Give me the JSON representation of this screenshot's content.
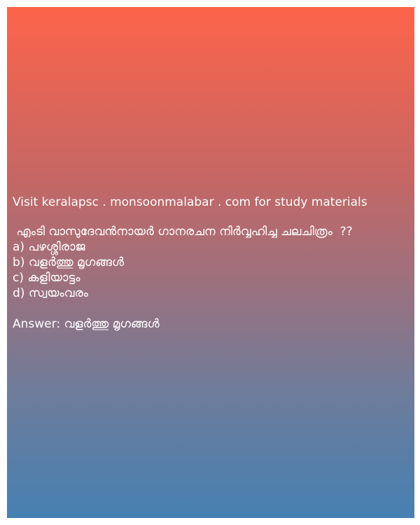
{
  "site_note": "Visit keralapsc . monsoonmalabar . com for study materials",
  "question": " എംടി വാസുദേവൻനായർ ഗാനരചന നിർവ്വഹിച്ച ചലചിത്രം  ??",
  "options": [
    "a) പഴശ്ശിരാജ",
    "b) വളർത്തു മൃഗങ്ങൾ",
    "c) കളിയാട്ടം",
    "d) സ്വയംവരം"
  ],
  "answer_label": "Answer: ",
  "answer_value": "വളർത്തു മൃഗങ്ങൾ",
  "colors": {
    "gradient_top": "#fd644a",
    "gradient_bottom": "#4680b2",
    "text": "#ffffff"
  }
}
